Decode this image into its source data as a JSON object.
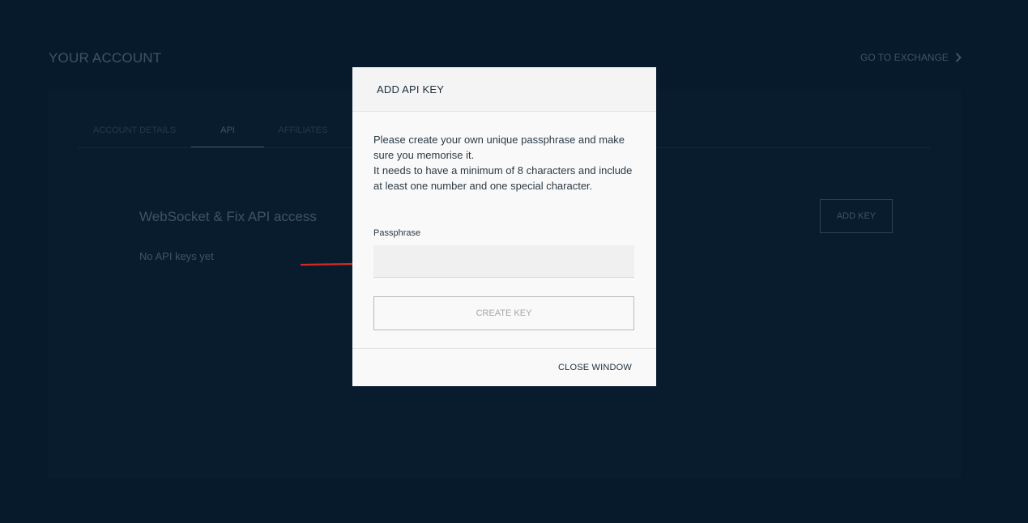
{
  "header": {
    "title": "YOUR ACCOUNT",
    "exchange_link": "GO TO EXCHANGE"
  },
  "tabs": [
    {
      "label": "ACCOUNT DETAILS"
    },
    {
      "label": "API"
    },
    {
      "label": "AFFILIATES"
    }
  ],
  "api_section": {
    "title": "WebSocket & Fix API access",
    "empty_message": "No API keys yet",
    "add_key_label": "ADD KEY"
  },
  "modal": {
    "title": "ADD API KEY",
    "description_line1": "Please create your own unique passphrase and make sure you memorise it.",
    "description_line2": "It needs to have a minimum of 8 characters and include at least one number and one special character.",
    "passphrase_label": "Passphrase",
    "passphrase_value": "",
    "create_key_label": "CREATE KEY",
    "close_label": "CLOSE WINDOW"
  },
  "icons": {
    "exchange_chevron": "chevron-right-icon",
    "pointer_arrow": "arrow-right-icon"
  },
  "colors": {
    "background": "#061a2b",
    "annotation_arrow": "#d42a22"
  }
}
